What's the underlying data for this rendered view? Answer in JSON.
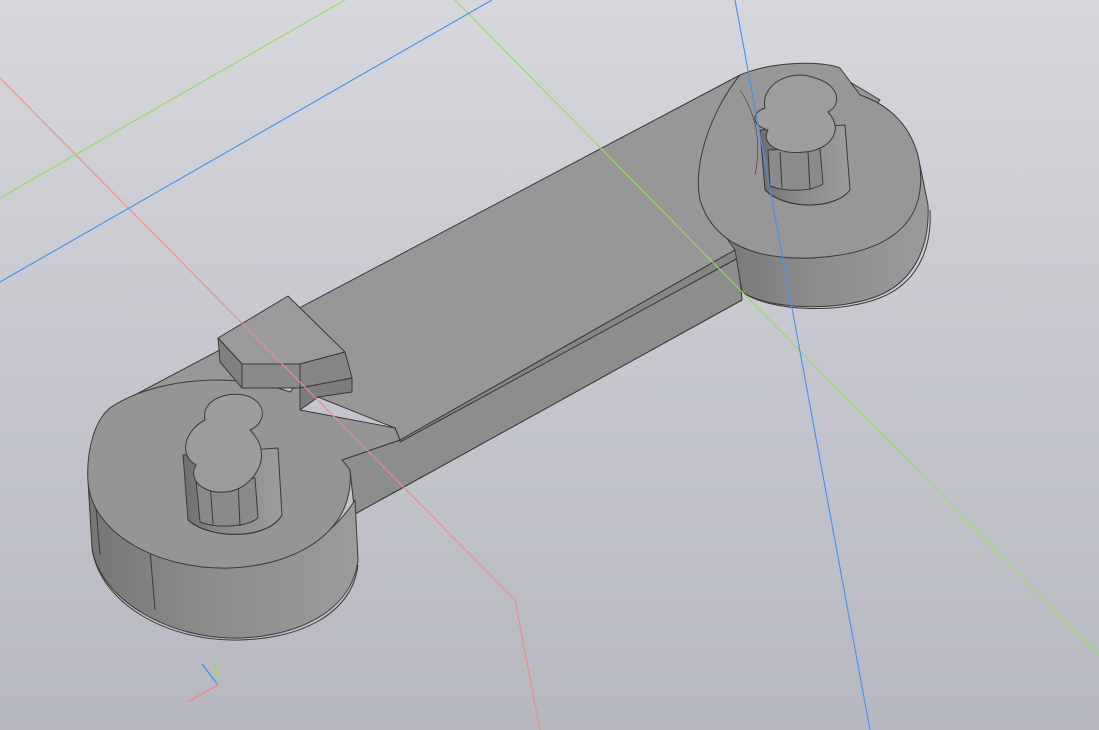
{
  "viewport": {
    "background_top": "#d6d7dc",
    "background_bottom": "#b5b6bf",
    "part_color": "#8e8e8e"
  },
  "axes": {
    "x_color": "#f08a8a",
    "y_color": "#8ee05a",
    "z_color": "#4a8ef0"
  },
  "icons": {
    "triad": "axis-triad-icon"
  }
}
